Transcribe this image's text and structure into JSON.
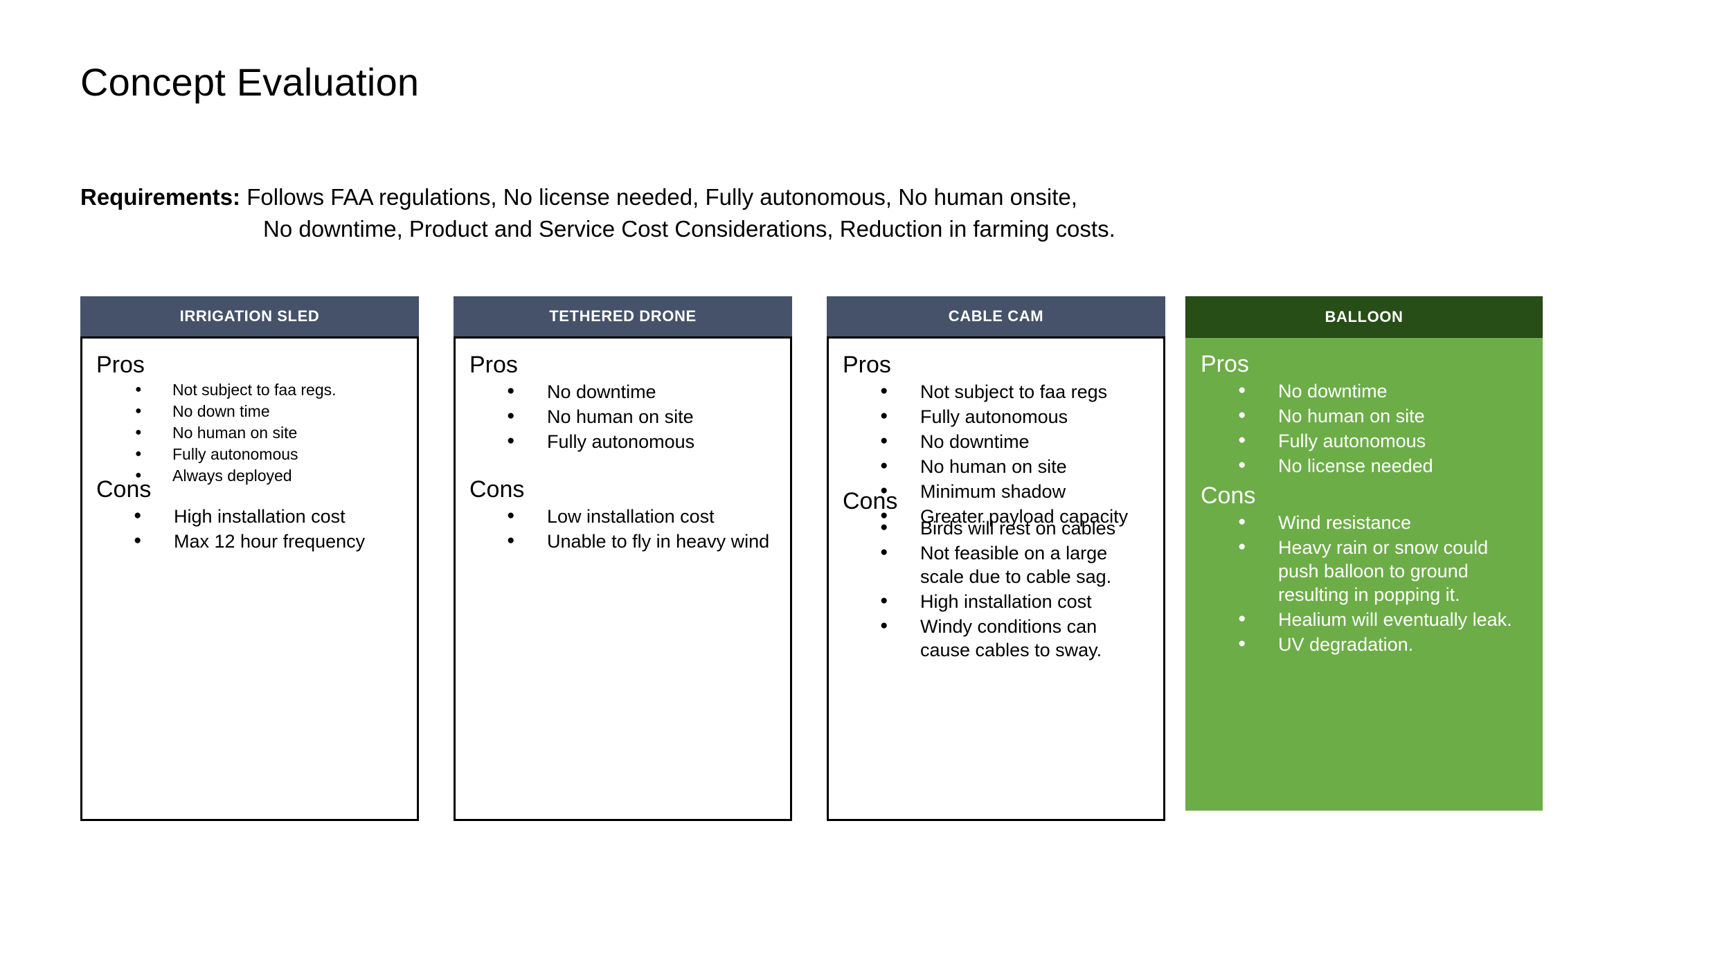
{
  "slide": {
    "title": "Concept Evaluation",
    "requirements": {
      "label": "Requirements:",
      "line1": "Follows FAA regulations, No license needed, Fully autonomous, No human onsite,",
      "line2": "No downtime, Product and Service Cost Considerations, Reduction in farming costs."
    }
  },
  "colors": {
    "header_blue": "#455269",
    "header_green_dark": "#274e16",
    "body_green": "#6cad47",
    "card_border": "#000000",
    "header_text": "#ffffff",
    "body_text": "#000000"
  },
  "labels": {
    "pros": "Pros",
    "cons": "Cons"
  },
  "cards": [
    {
      "title": "IRRIGATION SLED",
      "pros_label": "Pros",
      "cons_label": "Cons",
      "pros": [
        "Not subject to faa regs.",
        "No down time",
        "No human on site",
        "Fully autonomous",
        "Always deployed"
      ],
      "cons": [
        "High installation cost",
        "Max 12 hour frequency"
      ]
    },
    {
      "title": "TETHERED DRONE",
      "pros_label": "Pros",
      "cons_label": "Cons",
      "pros": [
        "No downtime",
        "No human on site",
        "Fully autonomous"
      ],
      "cons": [
        "Low installation cost",
        "Unable to fly in heavy wind"
      ]
    },
    {
      "title": "CABLE CAM",
      "pros_label": "Pros",
      "cons_label": "Cons",
      "pros": [
        "Not subject to faa regs",
        "Fully autonomous",
        "No downtime",
        "No human on site",
        "Minimum shadow",
        "Greater payload capacity"
      ],
      "cons": [
        "Birds will rest on cables",
        "Not feasible on a large scale due to cable sag.",
        "High installation cost",
        "Windy conditions can cause cables to sway."
      ]
    },
    {
      "title": "BALLOON",
      "pros_label": "Pros",
      "cons_label": "Cons",
      "pros": [
        "No downtime",
        "No human on site",
        "Fully autonomous",
        "No license needed"
      ],
      "cons": [
        "Wind resistance",
        "Heavy rain or snow could push balloon to ground resulting in popping it.",
        "Healium will eventually leak.",
        "UV degradation."
      ]
    }
  ]
}
